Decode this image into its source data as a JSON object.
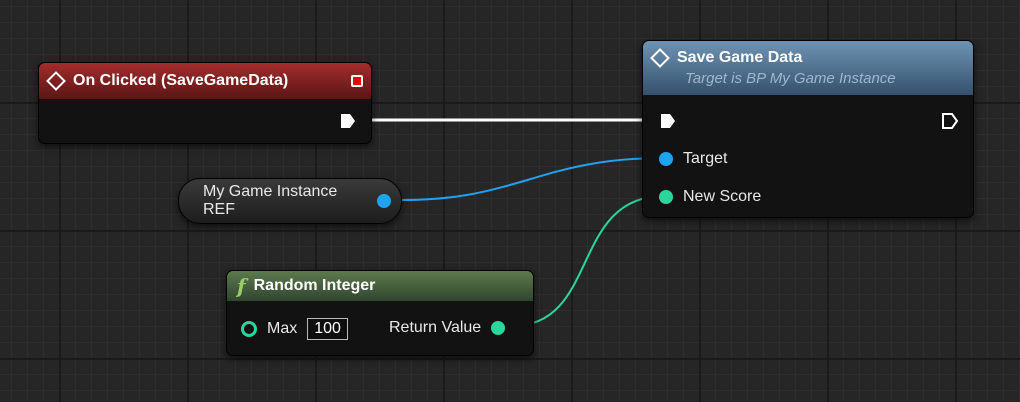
{
  "nodes": {
    "event": {
      "title": "On Clicked (SaveGameData)"
    },
    "save": {
      "title": "Save Game Data",
      "subtitle": "Target is BP My Game Instance",
      "pins": {
        "target": "Target",
        "new_score": "New Score"
      }
    },
    "variable": {
      "label": "My Game Instance REF"
    },
    "random": {
      "title": "Random Integer",
      "max_label": "Max",
      "max_value": "100",
      "return_label": "Return Value"
    }
  },
  "colors": {
    "exec_wire": "#ffffff",
    "object_wire": "#1fa2f0",
    "integer_wire": "#2bd69c",
    "event_header": "#a42c2c",
    "function_header": "#5c7a4d",
    "call_header": "#4f6f8e"
  }
}
